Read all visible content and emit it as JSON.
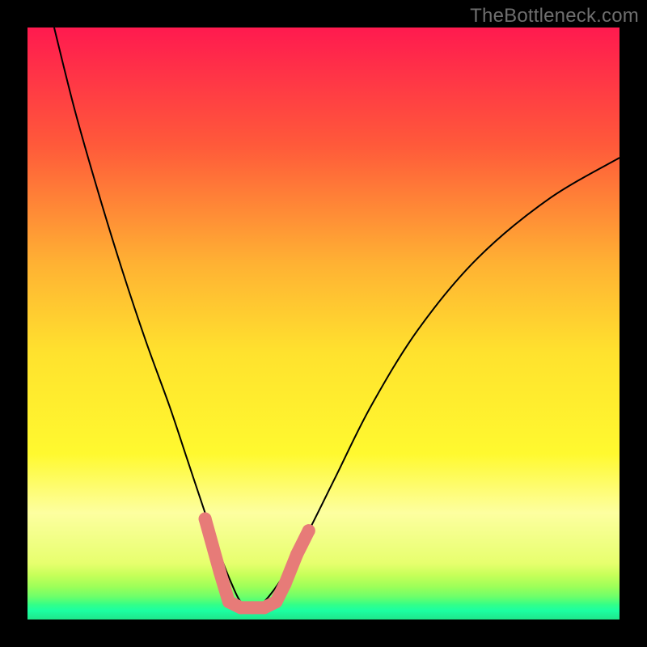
{
  "watermark": {
    "text": "TheBottleneck.com"
  },
  "chart_data": {
    "type": "line",
    "title": "",
    "xlabel": "",
    "ylabel": "",
    "xlim": [
      0,
      100
    ],
    "ylim": [
      0,
      100
    ],
    "grid": false,
    "legend": false,
    "background_gradient_stops": [
      {
        "pos": 0.0,
        "color": "#ff1a4f"
      },
      {
        "pos": 0.2,
        "color": "#ff5a3a"
      },
      {
        "pos": 0.4,
        "color": "#ffb233"
      },
      {
        "pos": 0.55,
        "color": "#ffe22e"
      },
      {
        "pos": 0.72,
        "color": "#fff92f"
      },
      {
        "pos": 0.82,
        "color": "#fdffa0"
      },
      {
        "pos": 0.905,
        "color": "#e7ff6e"
      },
      {
        "pos": 0.925,
        "color": "#c6ff59"
      },
      {
        "pos": 0.945,
        "color": "#9cff59"
      },
      {
        "pos": 0.962,
        "color": "#6bff6b"
      },
      {
        "pos": 0.975,
        "color": "#33ff88"
      },
      {
        "pos": 0.985,
        "color": "#1bffa2"
      },
      {
        "pos": 1.0,
        "color": "#1fe68a"
      }
    ],
    "series": [
      {
        "name": "bottleneck-curve",
        "color": "#000000",
        "x": [
          4.5,
          8,
          12,
          16,
          20,
          24,
          27,
          30,
          32.5,
          34.5,
          36,
          38,
          40,
          43,
          47,
          52,
          58,
          66,
          76,
          88,
          100
        ],
        "y": [
          100,
          86,
          72,
          59,
          47,
          36,
          27,
          18,
          11,
          6,
          3,
          1.5,
          3,
          7,
          14,
          24,
          36,
          49,
          61,
          71,
          78
        ]
      }
    ],
    "marker_points": {
      "color": "#e77b78",
      "radius_px": 8,
      "points": [
        {
          "x": 30.0,
          "y": 17
        },
        {
          "x": 32.5,
          "y": 8
        },
        {
          "x": 34.0,
          "y": 3
        },
        {
          "x": 36.0,
          "y": 2
        },
        {
          "x": 38.0,
          "y": 2
        },
        {
          "x": 40.0,
          "y": 2
        },
        {
          "x": 42.0,
          "y": 3
        },
        {
          "x": 43.5,
          "y": 6
        },
        {
          "x": 45.5,
          "y": 11
        },
        {
          "x": 47.5,
          "y": 15
        }
      ]
    }
  }
}
